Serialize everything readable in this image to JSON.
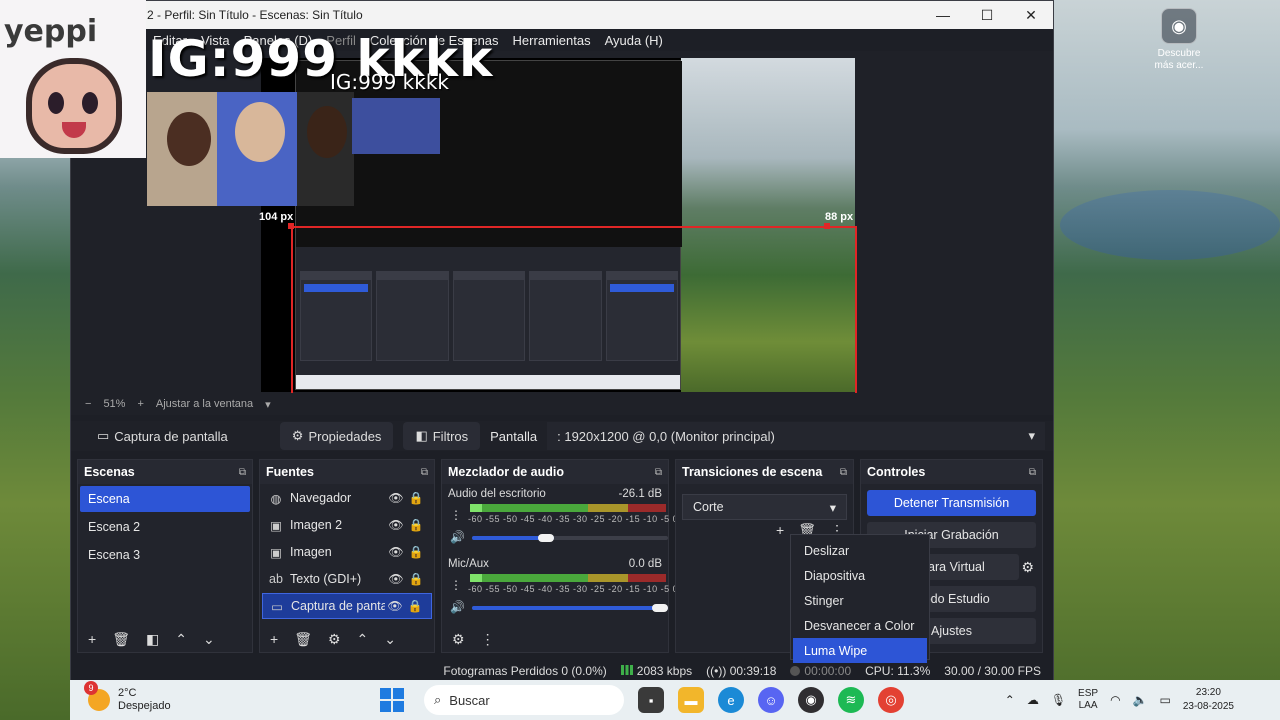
{
  "window": {
    "title": "2 - Perfil: Sin Título - Escenas: Sin Título",
    "minimize": "—",
    "maximize": "☐",
    "close": "✕"
  },
  "menu": {
    "items": [
      "Editar",
      "Vista",
      "Paneles (D)",
      "Perfil",
      "Colección de Escenas",
      "Herramientas",
      "Ayuda (H)"
    ]
  },
  "desktop": {
    "icon_label": "Descubre más acer..."
  },
  "preview": {
    "overlay_big": "IG:999 kkkk",
    "overlay_small": "IG:999 kkkk",
    "sticker_text": "yeppi",
    "label_left": "104 px",
    "label_right": "88 px"
  },
  "zoom": {
    "minus": "−",
    "percent": "51%",
    "plus": "+",
    "fit": "Ajustar a la ventana"
  },
  "source_bar": {
    "source_name": "Captura de pantalla",
    "properties": "Propiedades",
    "filters": "Filtros",
    "display_label": "Pantalla",
    "display_value": ": 1920x1200 @ 0,0 (Monitor principal)"
  },
  "scenes": {
    "title": "Escenas",
    "items": [
      "Escena",
      "Escena 2",
      "Escena 3"
    ]
  },
  "sources": {
    "title": "Fuentes",
    "items": [
      {
        "label": "Navegador",
        "icon": "globe-icon",
        "glyph": "◍"
      },
      {
        "label": "Imagen 2",
        "icon": "image-icon",
        "glyph": "▣"
      },
      {
        "label": "Imagen",
        "icon": "image-icon",
        "glyph": "▣"
      },
      {
        "label": "Texto (GDI+)",
        "icon": "text-icon",
        "glyph": "ab"
      },
      {
        "label": "Captura de panta",
        "icon": "monitor-icon",
        "glyph": "▭"
      }
    ]
  },
  "mixer": {
    "title": "Mezclador de audio",
    "ticks": "-60 -55 -50 -45 -40 -35 -30 -25 -20 -15 -10  -5   0",
    "channels": [
      {
        "name": "Audio del escritorio",
        "db": "-26.1 dB",
        "volume": 0.42,
        "level": 0.06
      },
      {
        "name": "Mic/Aux",
        "db": "0.0 dB",
        "volume": 1.0,
        "level": 0.06
      }
    ]
  },
  "transitions": {
    "title": "Transiciones de escena",
    "selected": "Corte",
    "menu": [
      "Deslizar",
      "Diapositiva",
      "Stinger",
      "Desvanecer a Color",
      "Luma Wipe"
    ],
    "highlighted": "Luma Wipe"
  },
  "controls": {
    "title": "Controles",
    "stop_stream": "Detener Transmisión",
    "start_recording": "Iniciar Grabación",
    "virtual_camera": "Cámara Virtual",
    "studio_mode": "Modo Estudio",
    "settings": "Ajustes"
  },
  "status": {
    "dropped": "Fotogramas Perdidos 0 (0.0%)",
    "bitrate": "2083 kbps",
    "stream_time": "00:39:18",
    "rec_time": "00:00:00",
    "cpu": "CPU: 11.3%",
    "fps": "30.00 / 30.00 FPS"
  },
  "taskbar": {
    "weather_badge": "9",
    "temperature": "2°C",
    "condition": "Despejado",
    "search": "Buscar",
    "lang_1": "ESP",
    "lang_2": "LAA",
    "time": "23:20",
    "date": "23-08-2025"
  },
  "colors": {
    "accent": "#2d55d6",
    "selection_red": "#e02626",
    "panel_bg": "#22242c"
  }
}
